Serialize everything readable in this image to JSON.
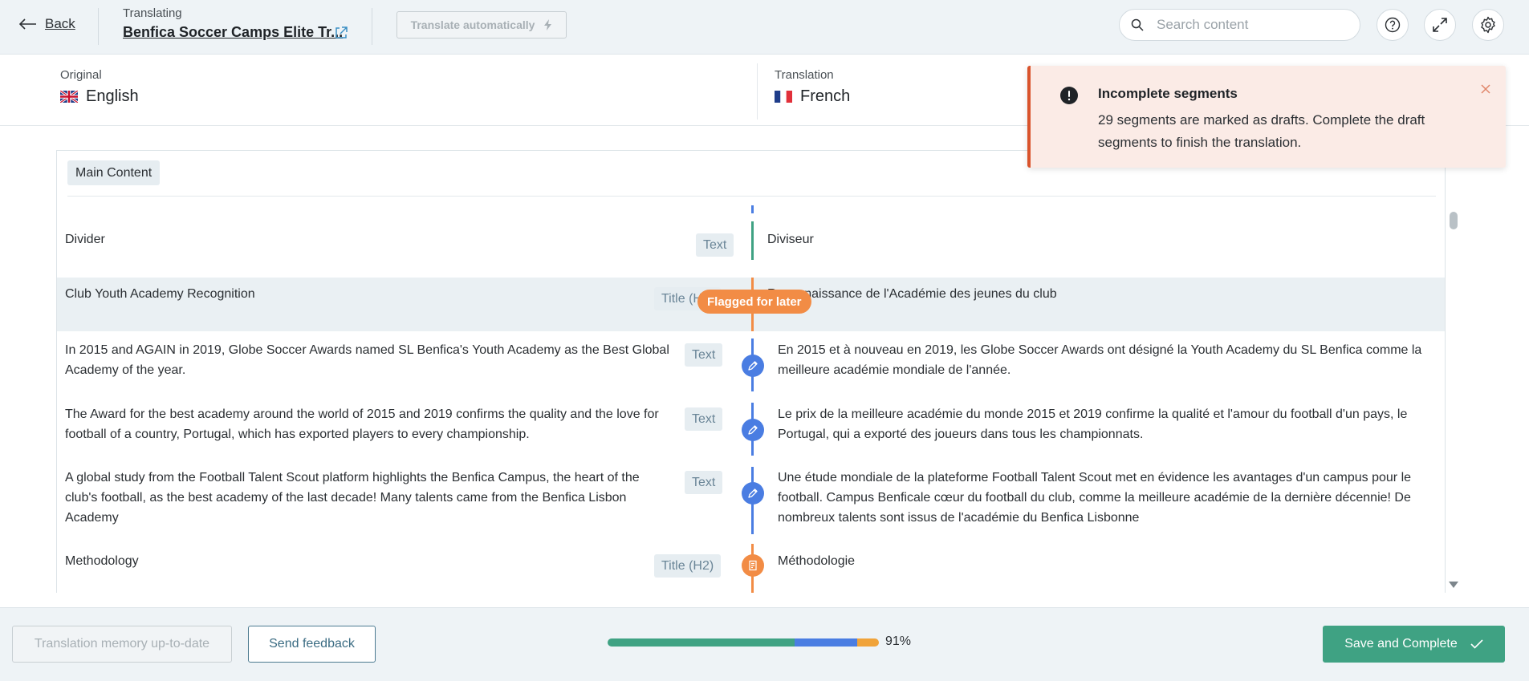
{
  "header": {
    "back_label": "Back",
    "translating_caption": "Translating",
    "page_title": "Benfica Soccer Camps Elite Tr...",
    "translate_auto_label": "Translate automatically",
    "search_placeholder": "Search content"
  },
  "languages": {
    "original_caption": "Original",
    "original_name": "English",
    "translation_caption": "Translation",
    "translation_name": "French"
  },
  "toast": {
    "title": "Incomplete segments",
    "message": "29 segments are marked as drafts. Complete the draft segments to finish the translation."
  },
  "content": {
    "section_label": "Main Content",
    "flag_pill": "Flagged for later",
    "segments": [
      {
        "source": "Divider",
        "type": "Text",
        "target": "Diviseur",
        "status": "complete"
      },
      {
        "source": "Club Youth Academy Recognition",
        "type": "Title (H2)",
        "target": "Reconnaissance de l'Académie des jeunes du club",
        "status": "flagged"
      },
      {
        "source": "In 2015 and AGAIN in 2019, Globe Soccer Awards named SL Benfica's Youth Academy as the Best Global Academy of the year.",
        "type": "Text",
        "target": "En 2015 et à nouveau en 2019, les Globe Soccer Awards ont désigné la Youth Academy du SL Benfica comme la meilleure académie mondiale de l'année.",
        "status": "draft"
      },
      {
        "source": "The Award for the best academy around the world of 2015 and 2019 confirms the quality and the love for football of a country, Portugal, which has exported players to every championship.",
        "type": "Text",
        "target": "Le prix de la meilleure académie du monde 2015 et 2019 confirme la qualité et l'amour du football d'un pays, le Portugal, qui a exporté des joueurs dans tous les championnats.",
        "status": "draft"
      },
      {
        "source": "A global study from the Football Talent Scout platform highlights the Benfica Campus, the heart of the club's football, as the best academy of the last decade! Many talents came from the Benfica Lisbon Academy",
        "type": "Text",
        "target": "Une étude mondiale de la plateforme Football Talent Scout met en évidence les avantages d'un campus pour le football. Campus Benficale cœur du football du club, comme la meilleure académie de la dernière décennie! De nombreux talents sont issus de l'académie du Benfica Lisbonne",
        "status": "draft"
      },
      {
        "source": "Methodology",
        "type": "Title (H2)",
        "target": "Méthodologie",
        "status": "note"
      }
    ]
  },
  "footer": {
    "tm_label": "Translation memory up-to-date",
    "feedback_label": "Send feedback",
    "progress_label": "91%",
    "progress": {
      "complete": 0.69,
      "draft": 0.23,
      "flagged": 0.08
    },
    "save_label": "Save and Complete"
  },
  "colors": {
    "complete": "#3fa283",
    "draft": "#4a7de2",
    "flagged": "#f28c45",
    "progress_orange": "#f0a33a",
    "toast_accent": "#d9532c"
  }
}
